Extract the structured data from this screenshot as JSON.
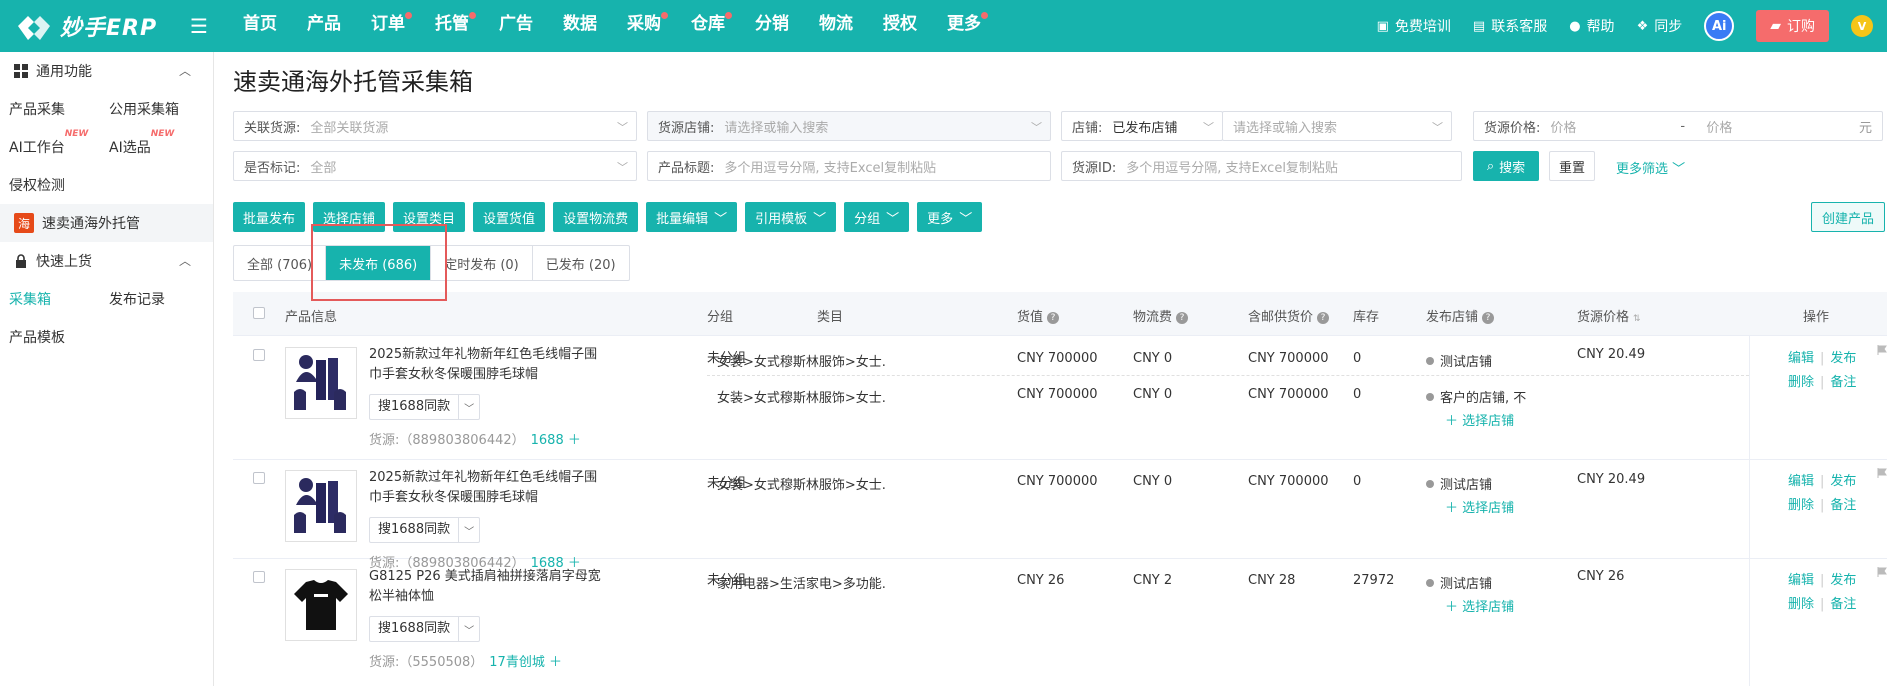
{
  "topbar": {
    "brand": "妙手ERP",
    "nav": [
      {
        "label": "首页",
        "dot": false
      },
      {
        "label": "产品",
        "dot": false
      },
      {
        "label": "订单",
        "dot": true
      },
      {
        "label": "托管",
        "dot": true
      },
      {
        "label": "广告",
        "dot": false
      },
      {
        "label": "数据",
        "dot": false
      },
      {
        "label": "采购",
        "dot": true
      },
      {
        "label": "仓库",
        "dot": true
      },
      {
        "label": "分销",
        "dot": false
      },
      {
        "label": "物流",
        "dot": false
      },
      {
        "label": "授权",
        "dot": false
      },
      {
        "label": "更多",
        "dot": true
      }
    ],
    "right": {
      "training": "免费培训",
      "support": "联系客服",
      "help": "帮助",
      "sync": "同步",
      "ai": "Ai",
      "order": "订购",
      "vip": "V"
    }
  },
  "sidebar": {
    "group1": "通用功能",
    "items1": [
      {
        "label": "产品采集",
        "new": ""
      },
      {
        "label": "公用采集箱",
        "new": ""
      },
      {
        "label": "AI工作台",
        "new": "NEW"
      },
      {
        "label": "AI选品",
        "new": "NEW"
      },
      {
        "label": "侵权检测",
        "new": ""
      }
    ],
    "special_icon": "海",
    "special": "速卖通海外托管",
    "group2": "快速上货",
    "items2": [
      "采集箱",
      "发布记录",
      "产品模板"
    ]
  },
  "page": {
    "title": "速卖通海外托管采集箱"
  },
  "filters": {
    "source_label": "关联货源:",
    "source_value": "全部关联货源",
    "source_store_label": "货源店铺:",
    "source_store_ph": "请选择或输入搜索",
    "store_label": "店铺:",
    "store_value": "已发布店铺",
    "store_ph": "请选择或输入搜索",
    "price_label": "货源价格:",
    "price_min_ph": "价格",
    "price_dash": "-",
    "price_max_ph": "价格",
    "price_unit": "元",
    "mark_label": "是否标记:",
    "mark_value": "全部",
    "title_label": "产品标题:",
    "title_ph": "多个用逗号分隔, 支持Excel复制粘贴",
    "id_label": "货源ID:",
    "id_ph": "多个用逗号分隔, 支持Excel复制粘贴",
    "search": "搜索",
    "reset": "重置",
    "more": "更多筛选"
  },
  "actions": {
    "buttons": [
      "批量发布",
      "选择店铺",
      "设置类目",
      "设置货值",
      "设置物流费"
    ],
    "dropdowns": [
      "批量编辑",
      "引用模板",
      "分组",
      "更多"
    ],
    "create": "创建产品"
  },
  "tabs": [
    "全部 (706)",
    "未发布 (686)",
    "定时发布 (0)",
    "已发布 (20)"
  ],
  "table": {
    "headers": {
      "product": "产品信息",
      "group": "分组",
      "category": "类目",
      "value": "货值",
      "logistics": "物流费",
      "shipping_price": "含邮供货价",
      "stock": "库存",
      "store": "发布店铺",
      "source_price": "货源价格",
      "ops": "操作"
    },
    "rows": [
      {
        "title": "2025新款过年礼物新年红色毛线帽子围巾手套女秋冬保暖围脖毛球帽",
        "search": "搜1688同款",
        "source": "货源:（889803806442）",
        "source_link": "1688 ＋",
        "group": "未分组",
        "lines": [
          {
            "category": "女装>女式穆斯林服饰>女士...",
            "value": "CNY 700000",
            "logistics": "CNY 0",
            "shipping": "CNY 700000",
            "stock": "0",
            "store": "测试店铺"
          },
          {
            "category": "女装>女式穆斯林服饰>女士...",
            "value": "CNY 700000",
            "logistics": "CNY 0",
            "shipping": "CNY 700000",
            "stock": "0",
            "store": "客户的店铺, 不"
          }
        ],
        "pick": "＋ 选择店铺",
        "source_price": "CNY 20.49",
        "ops": [
          "编辑",
          "发布",
          "删除",
          "备注"
        ]
      },
      {
        "title": "2025新款过年礼物新年红色毛线帽子围巾手套女秋冬保暖围脖毛球帽",
        "search": "搜1688同款",
        "source": "货源:（889803806442）",
        "source_link": "1688 ＋",
        "group": "未分组",
        "lines": [
          {
            "category": "女装>女式穆斯林服饰>女士...",
            "value": "CNY 700000",
            "logistics": "CNY 0",
            "shipping": "CNY 700000",
            "stock": "0",
            "store": "测试店铺"
          }
        ],
        "pick": "＋ 选择店铺",
        "source_price": "CNY 20.49",
        "ops": [
          "编辑",
          "发布",
          "删除",
          "备注"
        ]
      },
      {
        "title": "G8125 P26 美式插肩袖拼接落肩字母宽松半袖体恤",
        "search": "搜1688同款",
        "source": "货源:（5550508）",
        "source_link": "17青创城 ＋",
        "group": "未分组",
        "lines": [
          {
            "category": "家用电器>生活家电>多功能...",
            "value": "CNY 26",
            "logistics": "CNY 2",
            "shipping": "CNY 28",
            "stock": "27972",
            "store": "测试店铺"
          }
        ],
        "pick": "＋ 选择店铺",
        "source_price": "CNY 26",
        "ops": [
          "编辑",
          "发布",
          "删除",
          "备注"
        ]
      }
    ]
  }
}
